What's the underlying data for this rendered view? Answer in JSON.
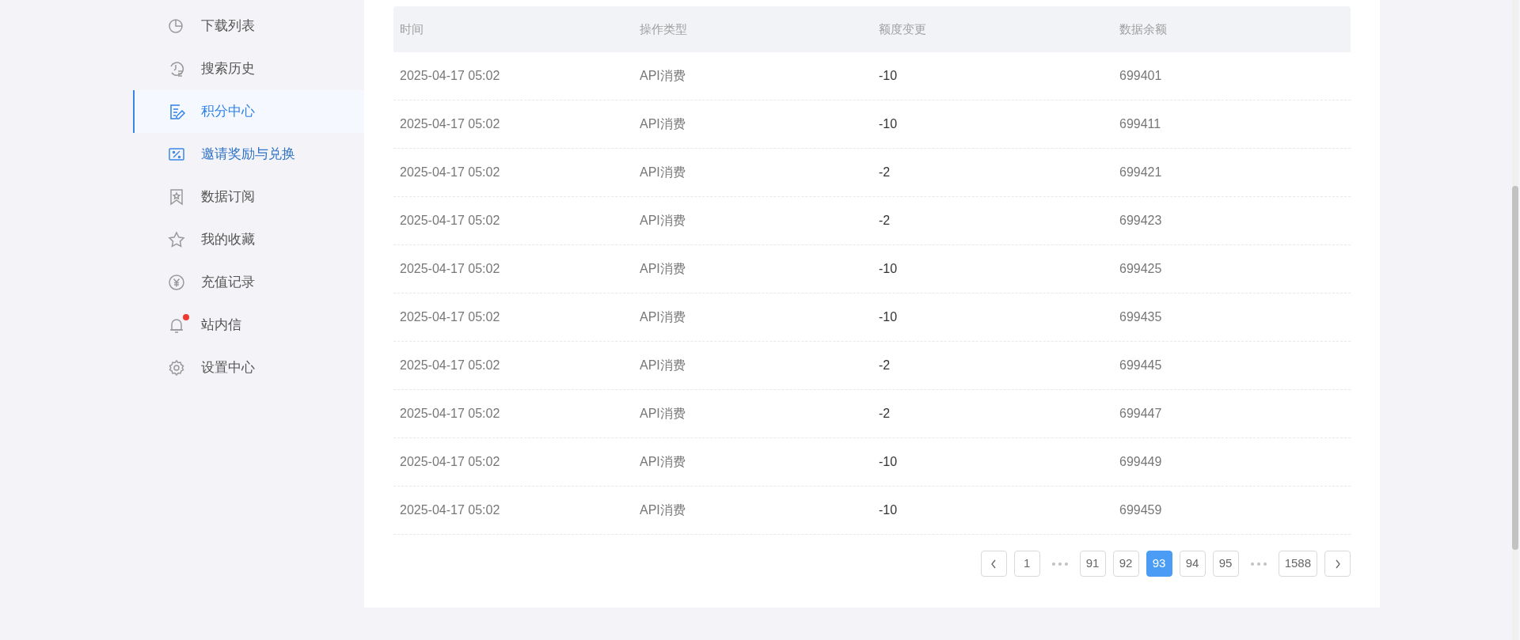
{
  "sidebar": {
    "items": [
      {
        "label": "下载列表",
        "kind": "pie",
        "selected": false,
        "badge": false
      },
      {
        "label": "搜索历史",
        "kind": "history",
        "selected": false,
        "badge": false
      },
      {
        "label": "积分中心",
        "kind": "points",
        "selected": true,
        "badge": false
      },
      {
        "label": "邀请奖励与兑换",
        "kind": "ticket",
        "selected": false,
        "badge": false
      },
      {
        "label": "数据订阅",
        "kind": "bookmark",
        "selected": false,
        "badge": false
      },
      {
        "label": "我的收藏",
        "kind": "star",
        "selected": false,
        "badge": false
      },
      {
        "label": "充值记录",
        "kind": "yen",
        "selected": false,
        "badge": false
      },
      {
        "label": "站内信",
        "kind": "bell",
        "selected": false,
        "badge": true
      },
      {
        "label": "设置中心",
        "kind": "gear",
        "selected": false,
        "badge": false
      }
    ]
  },
  "table": {
    "columns": [
      "时间",
      "操作类型",
      "额度变更",
      "数据余额"
    ],
    "rows": [
      [
        "2025-04-17 05:02",
        "API消费",
        "-10",
        "699401"
      ],
      [
        "2025-04-17 05:02",
        "API消费",
        "-10",
        "699411"
      ],
      [
        "2025-04-17 05:02",
        "API消费",
        "-2",
        "699421"
      ],
      [
        "2025-04-17 05:02",
        "API消费",
        "-2",
        "699423"
      ],
      [
        "2025-04-17 05:02",
        "API消费",
        "-10",
        "699425"
      ],
      [
        "2025-04-17 05:02",
        "API消费",
        "-10",
        "699435"
      ],
      [
        "2025-04-17 05:02",
        "API消费",
        "-2",
        "699445"
      ],
      [
        "2025-04-17 05:02",
        "API消费",
        "-2",
        "699447"
      ],
      [
        "2025-04-17 05:02",
        "API消费",
        "-10",
        "699449"
      ],
      [
        "2025-04-17 05:02",
        "API消费",
        "-10",
        "699459"
      ]
    ]
  },
  "pagination": {
    "items": [
      {
        "kind": "prev"
      },
      {
        "kind": "page",
        "label": "1",
        "selected": false
      },
      {
        "kind": "ellipsis"
      },
      {
        "kind": "page",
        "label": "91",
        "selected": false
      },
      {
        "kind": "page",
        "label": "92",
        "selected": false
      },
      {
        "kind": "page",
        "label": "93",
        "selected": true
      },
      {
        "kind": "page",
        "label": "94",
        "selected": false
      },
      {
        "kind": "page",
        "label": "95",
        "selected": false
      },
      {
        "kind": "ellipsis"
      },
      {
        "kind": "page",
        "label": "1588",
        "selected": false
      },
      {
        "kind": "next"
      }
    ]
  }
}
